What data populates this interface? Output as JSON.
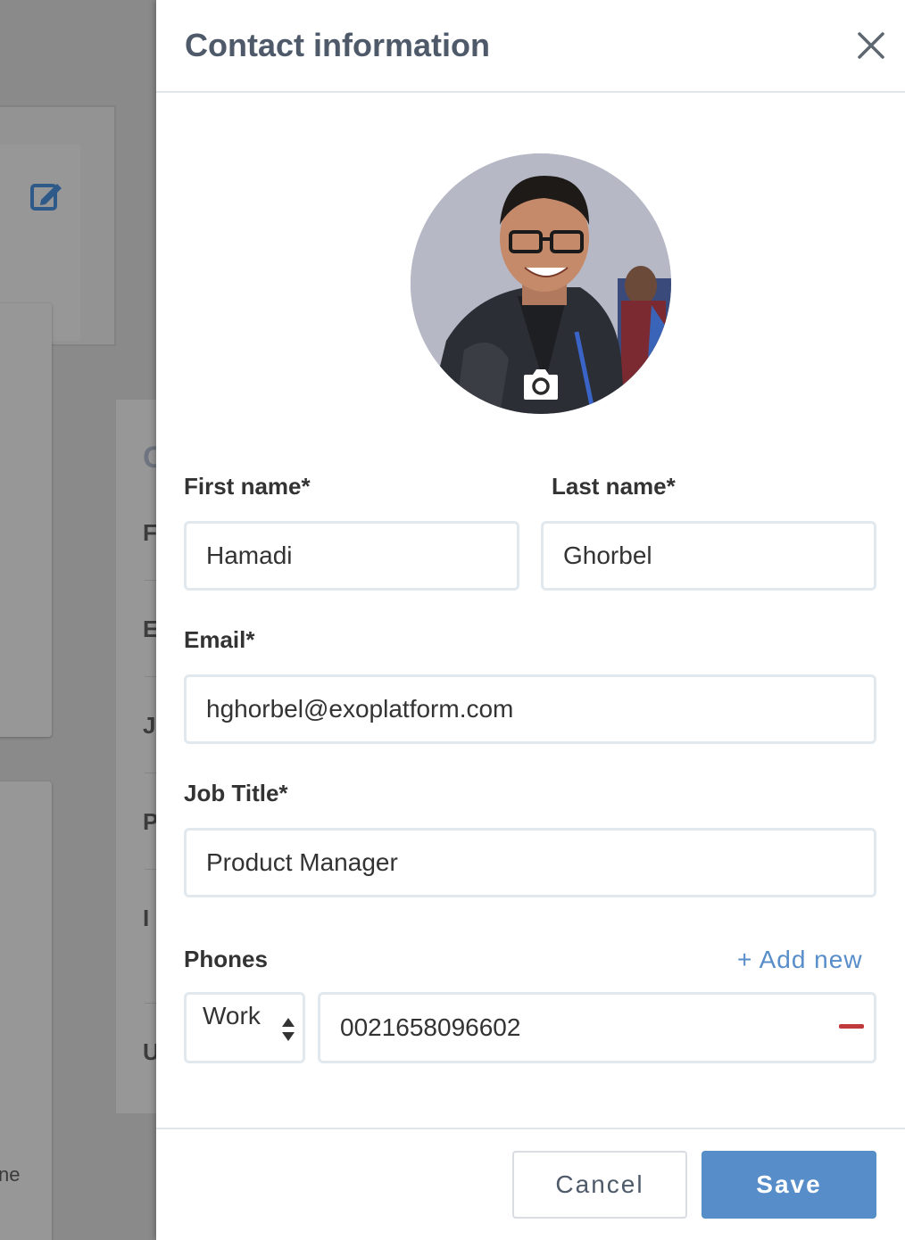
{
  "drawer": {
    "title": "Contact information",
    "close_label": "close"
  },
  "form": {
    "first_name": {
      "label": "First name*",
      "value": "Hamadi"
    },
    "last_name": {
      "label": "Last name*",
      "value": "Ghorbel"
    },
    "email": {
      "label": "Email*",
      "value": "hghorbel@exoplatform.com"
    },
    "job_title": {
      "label": "Job Title*",
      "value": "Product Manager"
    },
    "phones": {
      "label": "Phones",
      "add_new": "+ Add new",
      "items": [
        {
          "type": "Work",
          "number": "0021658096602"
        }
      ]
    }
  },
  "footer": {
    "cancel_label": "Cancel",
    "save_label": "Save"
  },
  "background": {
    "partial_letters": [
      "C",
      "F",
      "E",
      "J",
      "P",
      "I",
      "U"
    ],
    "bottom_text_fragment": "ne"
  },
  "colors": {
    "accent": "#578dc9",
    "title": "#4e5a6a",
    "remove": "#c0393b",
    "overlay": "#8a8a8a"
  },
  "icons": {
    "close": "close-icon",
    "camera": "camera-icon",
    "edit": "edit-icon",
    "remove": "minus-icon",
    "select": "select-arrows-icon"
  }
}
